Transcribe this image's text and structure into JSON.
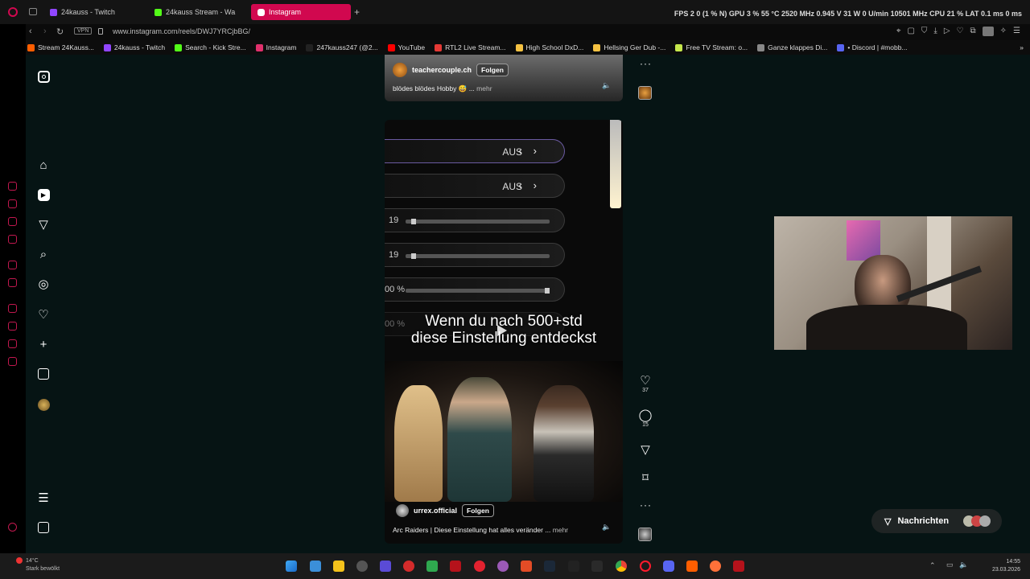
{
  "browser": {
    "tabs": [
      {
        "label": "24kauss - Twitch",
        "icon_color": "#9146ff"
      },
      {
        "label": "24kauss Stream - Wa",
        "icon_color": "#53fc18"
      },
      {
        "label": "Instagram",
        "icon_color": "#e1306c",
        "active": true
      }
    ],
    "new_tab_label": "+",
    "perf_overlay": "FPS  2   0 (1 % N)    GPU  3 %  55 °C  2520 MHz  0.945 V  31 W  0 U/min  10501 MHz     CPU  21 %     LAT  0.1 ms  0 ms",
    "url": "www.instagram.com/reels/DWJ7YRCjbBG/",
    "vpn_label": "VPN",
    "bookmarks": [
      {
        "label": "Stream 24Kauss...",
        "color": "#ff5e00"
      },
      {
        "label": "24kauss - Twitch",
        "color": "#9146ff"
      },
      {
        "label": "Search - Kick Stre...",
        "color": "#53fc18"
      },
      {
        "label": "Instagram",
        "color": "#e1306c"
      },
      {
        "label": "247kauss247 (@2...",
        "color": "#222222"
      },
      {
        "label": "YouTube",
        "color": "#ff0000"
      },
      {
        "label": "RTL2 Live Stream...",
        "color": "#e53935"
      },
      {
        "label": "High School DxD...",
        "color": "#f5c242"
      },
      {
        "label": "Hellsing Ger Dub -...",
        "color": "#f5c242"
      },
      {
        "label": "Free TV Stream: o...",
        "color": "#c6e84c"
      },
      {
        "label": "Ganze klappes Di...",
        "color": "#888888"
      },
      {
        "label": "• Discord | #mobb...",
        "color": "#5865f2"
      }
    ]
  },
  "reel_top": {
    "handle": "teachercouple.ch",
    "follow_label": "Folgen",
    "description": "blödes blödes Hobby 😅 ...",
    "more_label": "mehr"
  },
  "reel_main": {
    "settings": [
      {
        "value": "AUS",
        "type": "toggle"
      },
      {
        "value": "AUS",
        "type": "toggle"
      },
      {
        "number": "19",
        "type": "slider",
        "level": 0.07
      },
      {
        "number": "19",
        "type": "slider",
        "level": 0.07
      },
      {
        "number": "00 %",
        "type": "slider",
        "level": 1.0
      },
      {
        "number": "00 %",
        "type": "slider",
        "level": 1.0
      }
    ],
    "caption_line1": "Wenn du nach 500+std",
    "caption_line2": "diese Einstellung entdeckst",
    "handle": "urrex.official",
    "follow_label": "Folgen",
    "description": "Arc Raiders | Diese Einstellung hat alles veränder ...",
    "more_label": "mehr"
  },
  "actions": {
    "likes": "37",
    "comments": "15"
  },
  "messages": {
    "label": "Nachrichten"
  },
  "taskbar": {
    "weather_temp": "14°C",
    "weather_desc": "Stark bewölkt",
    "time": "14:55",
    "date": "23.03.2026"
  }
}
